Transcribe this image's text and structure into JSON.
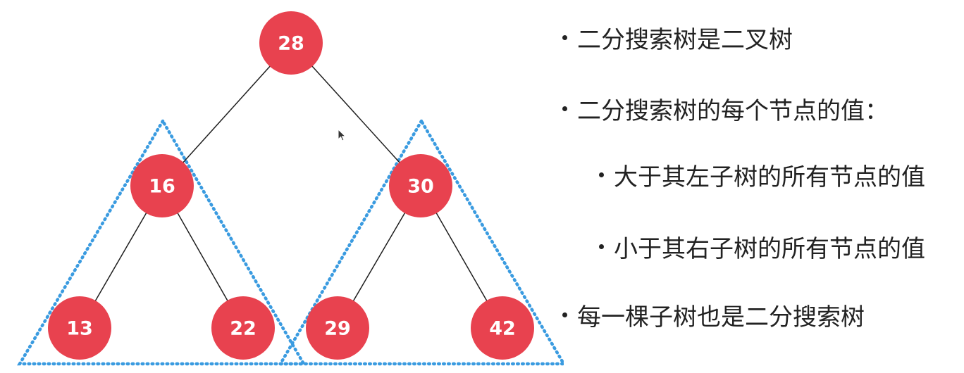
{
  "colors": {
    "node_fill": "#e8424f",
    "edge": "#1e1e1e",
    "subtree_outline": "#3a9be0",
    "text": "#222222"
  },
  "tree": {
    "root": "28",
    "left_child": "16",
    "right_child": "30",
    "left_left": "13",
    "left_right": "22",
    "right_left": "29",
    "right_right": "42"
  },
  "bullets": [
    {
      "text": "二分搜索树是二叉树",
      "level": 0
    },
    {
      "text": "二分搜索树的每个节点的值：",
      "level": 0
    },
    {
      "text": "大于其左子树的所有节点的值",
      "level": 1
    },
    {
      "text": "小于其右子树的所有节点的值",
      "level": 1
    },
    {
      "text": "每一棵子树也是二分搜索树",
      "level": 0
    }
  ],
  "cursor": "mouse-pointer-icon"
}
